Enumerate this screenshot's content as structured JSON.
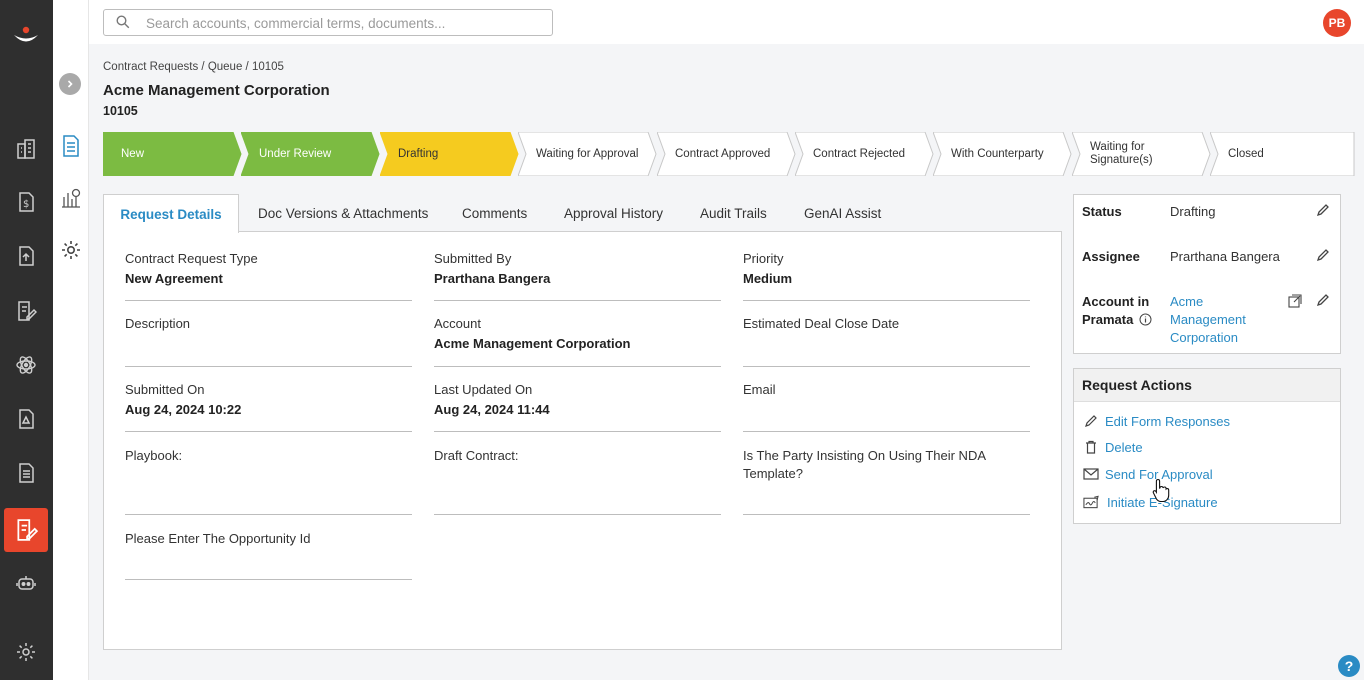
{
  "search": {
    "placeholder": "Search accounts, commercial terms, documents..."
  },
  "user": {
    "initials": "PB"
  },
  "breadcrumb": "Contract Requests / Queue / 10105",
  "page": {
    "title": "Acme Management Corporation",
    "id": "10105"
  },
  "stages": [
    {
      "label": "New",
      "state": "done"
    },
    {
      "label": "Under Review",
      "state": "done"
    },
    {
      "label": "Drafting",
      "state": "current"
    },
    {
      "label": "Waiting for Approval",
      "state": "pending"
    },
    {
      "label": "Contract Approved",
      "state": "pending"
    },
    {
      "label": "Contract Rejected",
      "state": "pending"
    },
    {
      "label": "With Counterparty",
      "state": "pending"
    },
    {
      "label": "Waiting for Signature(s)",
      "state": "pending"
    },
    {
      "label": "Closed",
      "state": "pending"
    }
  ],
  "tabs": [
    {
      "label": "Request Details",
      "active": true
    },
    {
      "label": "Doc Versions & Attachments"
    },
    {
      "label": "Comments"
    },
    {
      "label": "Approval History"
    },
    {
      "label": "Audit Trails"
    },
    {
      "label": "GenAI Assist"
    }
  ],
  "fields": [
    {
      "label": "Contract Request Type",
      "value": "New Agreement"
    },
    {
      "label": "Submitted By",
      "value": "Prarthana Bangera"
    },
    {
      "label": "Priority",
      "value": "Medium"
    },
    {
      "label": "Description",
      "value": ""
    },
    {
      "label": "Account",
      "value": "Acme Management Corporation"
    },
    {
      "label": "Estimated Deal Close Date",
      "value": ""
    },
    {
      "label": "Submitted On",
      "value": "Aug 24, 2024 10:22"
    },
    {
      "label": "Last Updated On",
      "value": "Aug 24, 2024 11:44"
    },
    {
      "label": "Email",
      "value": ""
    },
    {
      "label": "Playbook:",
      "value": ""
    },
    {
      "label": "Draft Contract:",
      "value": ""
    },
    {
      "label": "Is The Party Insisting On Using Their NDA Template?",
      "value": ""
    },
    {
      "label": "Please Enter The Opportunity Id",
      "value": ""
    }
  ],
  "status_panel": {
    "status_label": "Status",
    "status_value": "Drafting",
    "assignee_label": "Assignee",
    "assignee_value": "Prarthana Bangera",
    "account_label": "Account in Pramata",
    "account_value": "Acme Management Corporation"
  },
  "actions": {
    "title": "Request Actions",
    "items": [
      {
        "label": "Edit Form Responses",
        "icon": "pencil-icon"
      },
      {
        "label": "Delete",
        "icon": "trash-icon"
      },
      {
        "label": "Send For Approval",
        "icon": "envelope-icon"
      },
      {
        "label": "Initiate E-Signature",
        "icon": "signature-icon"
      }
    ]
  },
  "colors": {
    "done": "#7cbb42",
    "current": "#f5cb1f",
    "accent": "#e8462c",
    "link": "#2a8bc4"
  }
}
